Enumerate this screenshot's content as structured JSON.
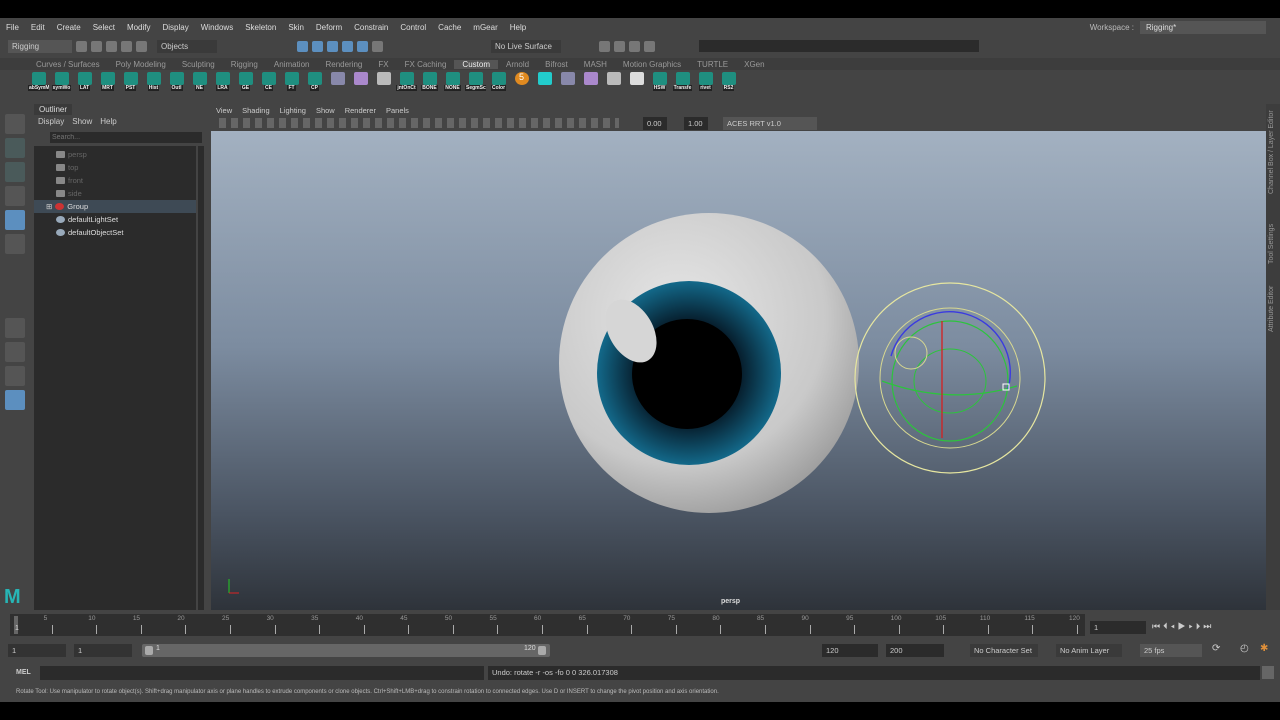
{
  "menu": [
    "File",
    "Edit",
    "Create",
    "Select",
    "Modify",
    "Display",
    "Windows",
    "Skeleton",
    "Skin",
    "Deform",
    "Constrain",
    "Control",
    "Cache",
    "mGear",
    "Help"
  ],
  "workspace": {
    "label": "Workspace :",
    "value": "Rigging*"
  },
  "status": {
    "mode": "Rigging",
    "objects": "Objects",
    "live_surface": "No Live Surface"
  },
  "shelf_tabs": [
    "Curves / Surfaces",
    "Poly Modeling",
    "Sculpting",
    "Rigging",
    "Animation",
    "Rendering",
    "FX",
    "FX Caching",
    "Custom",
    "Arnold",
    "Bifrost",
    "MASH",
    "Motion Graphics",
    "TURTLE",
    "XGen"
  ],
  "shelf_active": "Custom",
  "shelf_buttons": [
    "abSymM",
    "symWo",
    "LAT",
    "MRT",
    "PST",
    "Hist",
    "Outl",
    "NE",
    "LRA",
    "GE",
    "CE",
    "FT",
    "CP",
    "",
    "",
    "",
    "jntOnCt",
    "BONE",
    "NONE",
    "SegmSc",
    "Color",
    "5",
    "",
    "",
    "",
    "",
    "",
    "HSW",
    "Transfe",
    "rivet",
    "RS2"
  ],
  "outliner": {
    "title": "Outliner",
    "menu": [
      "Display",
      "Show",
      "Help"
    ],
    "search_placeholder": "Search...",
    "items": [
      {
        "name": "persp",
        "dim": true
      },
      {
        "name": "top",
        "dim": true
      },
      {
        "name": "front",
        "dim": true
      },
      {
        "name": "side",
        "dim": true
      },
      {
        "name": "Group",
        "dim": false,
        "selected": true
      },
      {
        "name": "defaultLightSet",
        "dim": false
      },
      {
        "name": "defaultObjectSet",
        "dim": false
      }
    ]
  },
  "viewport": {
    "menu": [
      "View",
      "Shading",
      "Lighting",
      "Show",
      "Renderer",
      "Panels"
    ],
    "exposure": "0.00",
    "gamma": "1.00",
    "color_space": "ACES RRT v1.0",
    "camera_label": "persp"
  },
  "side_tabs": [
    "Channel Box / Layer Editor",
    "Tool Settings",
    "Attribute Editor"
  ],
  "timeline": {
    "ticks": [
      5,
      10,
      15,
      20,
      25,
      30,
      35,
      40,
      45,
      50,
      55,
      60,
      65,
      70,
      75,
      80,
      85,
      90,
      95,
      100,
      105,
      110,
      115,
      120
    ],
    "current_frame": "1",
    "current_marker": "1"
  },
  "range": {
    "start": "1",
    "playback_start": "1",
    "slider_start": "1",
    "slider_end": "120",
    "playback_end": "120",
    "end": "200",
    "character_set": "No Character Set",
    "anim_layer": "No Anim Layer",
    "fps": "25 fps"
  },
  "command": {
    "lang": "MEL",
    "result": "Undo: rotate -r -os -fo 0 0 326.017308"
  },
  "help_line": "Rotate Tool: Use manipulator to rotate object(s). Shift+drag manipulator axis or plane handles to extrude components or clone objects. Ctrl+Shift+LMB+drag to constrain rotation to connected edges. Use D or INSERT to change the pivot position and axis orientation.",
  "colors": {
    "accent": "#5c8fbf",
    "shelf_icon": "#1f8f80",
    "iris": "#0f4f6a"
  }
}
